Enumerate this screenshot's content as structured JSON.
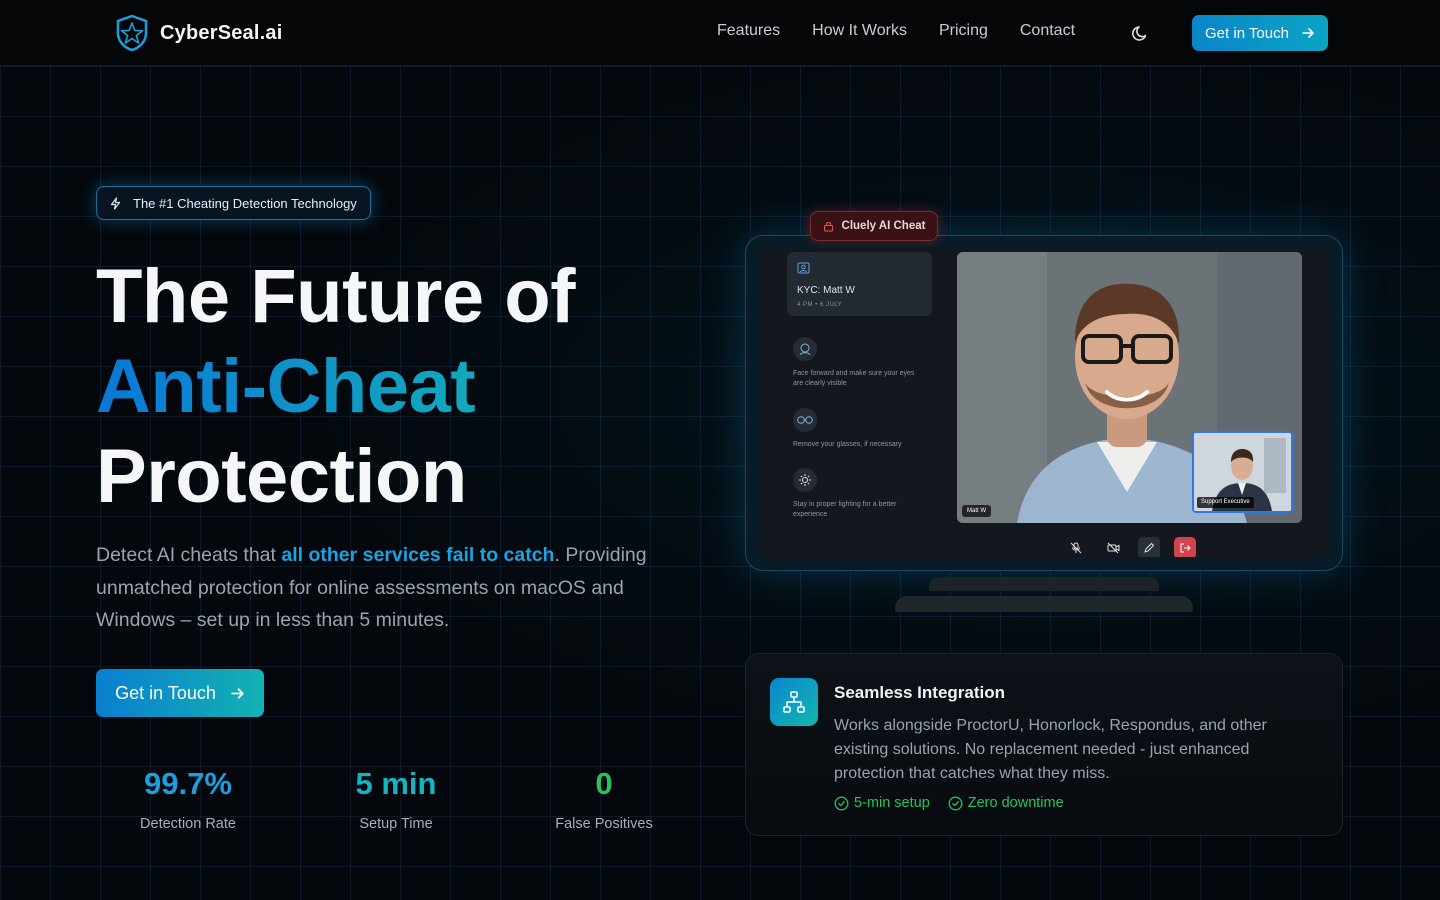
{
  "nav": {
    "brand": "CyberSeal.ai",
    "links": [
      "Features",
      "How It Works",
      "Pricing",
      "Contact"
    ],
    "cta": "Get in Touch"
  },
  "hero": {
    "badge": "The #1 Cheating Detection Technology",
    "title_line1": "The Future of",
    "title_line2": "Anti-Cheat",
    "title_line3": "Protection",
    "subtitle_pre": "Detect AI cheats that ",
    "subtitle_highlight": "all other services fail to catch",
    "subtitle_post": ". Providing unmatched protection for online assessments on macOS and Windows – set up in less than 5 minutes.",
    "cta": "Get in Touch",
    "stats": [
      {
        "value": "99.7%",
        "label": "Detection Rate",
        "color": "#1a9fe0"
      },
      {
        "value": "5 min",
        "label": "Setup Time",
        "color": "#14b4c0"
      },
      {
        "value": "0",
        "label": "False Positives",
        "color": "#22c55e"
      }
    ]
  },
  "mockup": {
    "cheat_tag": "Cluely AI Cheat",
    "kyc_title": "KYC: Matt W",
    "kyc_date": "4 PM • 6 JULY",
    "tips": [
      "Face forward and make sure your eyes are clearly visible",
      "Remove your glasses, if necessary",
      "Stay in proper lighting for a better experience"
    ],
    "main_video_label": "Matt W",
    "pip_label": "Support Executive"
  },
  "feature": {
    "title": "Seamless Integration",
    "description": "Works alongside ProctorU, Honorlock, Respondus, and other existing solutions. No replacement needed - just enhanced protection that catches what they miss.",
    "tags": [
      "5-min setup",
      "Zero downtime"
    ]
  },
  "colors": {
    "accent": "#0a86c8",
    "accent_teal": "#12b2b2",
    "success": "#22c55e",
    "danger": "#c8323c"
  }
}
